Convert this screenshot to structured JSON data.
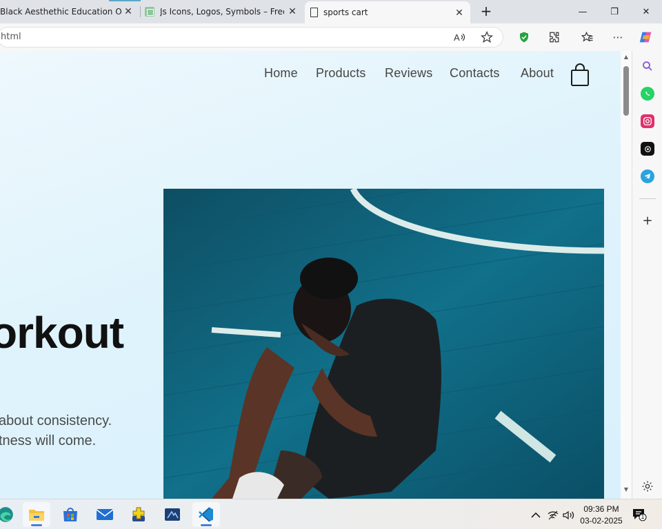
{
  "browser": {
    "tabs": [
      {
        "title": "Black Aesthethic Education Online",
        "active": false
      },
      {
        "title": "Js Icons, Logos, Symbols – Free Do",
        "active": false
      },
      {
        "title": "sports cart",
        "active": true
      }
    ],
    "new_tab_symbol": "+",
    "window_controls": {
      "minimize": "—",
      "restore": "❐",
      "close": "✕"
    },
    "address": "html",
    "toolbar_icons": [
      "read-aloud-icon",
      "favorite-star-icon",
      "shield-extension-icon",
      "extensions-icon",
      "favorites-icon",
      "more-icon",
      "copilot-icon"
    ]
  },
  "page": {
    "nav": {
      "links": [
        "Home",
        "Products",
        "Reviews",
        "Contacts",
        "About"
      ],
      "cart_icon": "shopping-bag-icon"
    },
    "hero": {
      "title": "orkout",
      "text_line_1": "about consistency.",
      "text_line_2": "tness will come."
    },
    "hero_image": "basketball-player-sitting-on-court"
  },
  "edge_sidebar": {
    "icons": [
      "search-icon",
      "whatsapp-icon",
      "instagram-icon",
      "chatgpt-icon",
      "telegram-icon",
      "add-icon",
      "settings-icon"
    ],
    "colors": {
      "whatsapp": "#25d366",
      "instagram": "#e1306c",
      "chatgpt": "#111111",
      "telegram": "#2aa3df",
      "search": "#8a5cd6"
    }
  },
  "taskbar": {
    "apps": [
      "edge-icon",
      "file-explorer-icon",
      "microsoft-store-icon",
      "mail-icon",
      "app-plus-icon",
      "app-settings-icon",
      "vscode-icon"
    ],
    "time": "09:36 PM",
    "date": "03-02-2025",
    "notification_count": "1",
    "tray_icons": [
      "chevron-up-icon",
      "network-icon",
      "volume-icon"
    ]
  },
  "colors": {
    "accent": "#4a7fd6",
    "page_bg": "#e3f5fd"
  }
}
